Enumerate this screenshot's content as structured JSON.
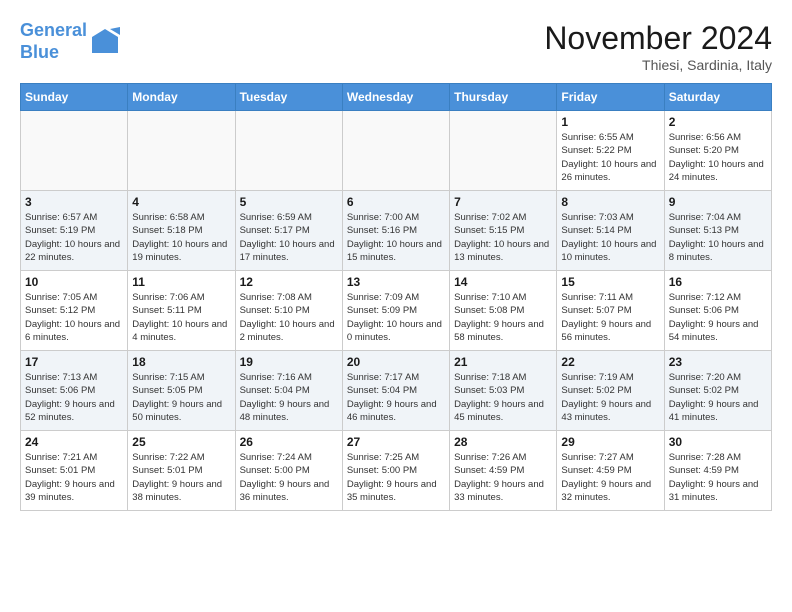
{
  "header": {
    "logo_line1": "General",
    "logo_line2": "Blue",
    "month_title": "November 2024",
    "subtitle": "Thiesi, Sardinia, Italy"
  },
  "weekdays": [
    "Sunday",
    "Monday",
    "Tuesday",
    "Wednesday",
    "Thursday",
    "Friday",
    "Saturday"
  ],
  "weeks": [
    [
      {
        "day": "",
        "info": ""
      },
      {
        "day": "",
        "info": ""
      },
      {
        "day": "",
        "info": ""
      },
      {
        "day": "",
        "info": ""
      },
      {
        "day": "",
        "info": ""
      },
      {
        "day": "1",
        "info": "Sunrise: 6:55 AM\nSunset: 5:22 PM\nDaylight: 10 hours and 26 minutes."
      },
      {
        "day": "2",
        "info": "Sunrise: 6:56 AM\nSunset: 5:20 PM\nDaylight: 10 hours and 24 minutes."
      }
    ],
    [
      {
        "day": "3",
        "info": "Sunrise: 6:57 AM\nSunset: 5:19 PM\nDaylight: 10 hours and 22 minutes."
      },
      {
        "day": "4",
        "info": "Sunrise: 6:58 AM\nSunset: 5:18 PM\nDaylight: 10 hours and 19 minutes."
      },
      {
        "day": "5",
        "info": "Sunrise: 6:59 AM\nSunset: 5:17 PM\nDaylight: 10 hours and 17 minutes."
      },
      {
        "day": "6",
        "info": "Sunrise: 7:00 AM\nSunset: 5:16 PM\nDaylight: 10 hours and 15 minutes."
      },
      {
        "day": "7",
        "info": "Sunrise: 7:02 AM\nSunset: 5:15 PM\nDaylight: 10 hours and 13 minutes."
      },
      {
        "day": "8",
        "info": "Sunrise: 7:03 AM\nSunset: 5:14 PM\nDaylight: 10 hours and 10 minutes."
      },
      {
        "day": "9",
        "info": "Sunrise: 7:04 AM\nSunset: 5:13 PM\nDaylight: 10 hours and 8 minutes."
      }
    ],
    [
      {
        "day": "10",
        "info": "Sunrise: 7:05 AM\nSunset: 5:12 PM\nDaylight: 10 hours and 6 minutes."
      },
      {
        "day": "11",
        "info": "Sunrise: 7:06 AM\nSunset: 5:11 PM\nDaylight: 10 hours and 4 minutes."
      },
      {
        "day": "12",
        "info": "Sunrise: 7:08 AM\nSunset: 5:10 PM\nDaylight: 10 hours and 2 minutes."
      },
      {
        "day": "13",
        "info": "Sunrise: 7:09 AM\nSunset: 5:09 PM\nDaylight: 10 hours and 0 minutes."
      },
      {
        "day": "14",
        "info": "Sunrise: 7:10 AM\nSunset: 5:08 PM\nDaylight: 9 hours and 58 minutes."
      },
      {
        "day": "15",
        "info": "Sunrise: 7:11 AM\nSunset: 5:07 PM\nDaylight: 9 hours and 56 minutes."
      },
      {
        "day": "16",
        "info": "Sunrise: 7:12 AM\nSunset: 5:06 PM\nDaylight: 9 hours and 54 minutes."
      }
    ],
    [
      {
        "day": "17",
        "info": "Sunrise: 7:13 AM\nSunset: 5:06 PM\nDaylight: 9 hours and 52 minutes."
      },
      {
        "day": "18",
        "info": "Sunrise: 7:15 AM\nSunset: 5:05 PM\nDaylight: 9 hours and 50 minutes."
      },
      {
        "day": "19",
        "info": "Sunrise: 7:16 AM\nSunset: 5:04 PM\nDaylight: 9 hours and 48 minutes."
      },
      {
        "day": "20",
        "info": "Sunrise: 7:17 AM\nSunset: 5:04 PM\nDaylight: 9 hours and 46 minutes."
      },
      {
        "day": "21",
        "info": "Sunrise: 7:18 AM\nSunset: 5:03 PM\nDaylight: 9 hours and 45 minutes."
      },
      {
        "day": "22",
        "info": "Sunrise: 7:19 AM\nSunset: 5:02 PM\nDaylight: 9 hours and 43 minutes."
      },
      {
        "day": "23",
        "info": "Sunrise: 7:20 AM\nSunset: 5:02 PM\nDaylight: 9 hours and 41 minutes."
      }
    ],
    [
      {
        "day": "24",
        "info": "Sunrise: 7:21 AM\nSunset: 5:01 PM\nDaylight: 9 hours and 39 minutes."
      },
      {
        "day": "25",
        "info": "Sunrise: 7:22 AM\nSunset: 5:01 PM\nDaylight: 9 hours and 38 minutes."
      },
      {
        "day": "26",
        "info": "Sunrise: 7:24 AM\nSunset: 5:00 PM\nDaylight: 9 hours and 36 minutes."
      },
      {
        "day": "27",
        "info": "Sunrise: 7:25 AM\nSunset: 5:00 PM\nDaylight: 9 hours and 35 minutes."
      },
      {
        "day": "28",
        "info": "Sunrise: 7:26 AM\nSunset: 4:59 PM\nDaylight: 9 hours and 33 minutes."
      },
      {
        "day": "29",
        "info": "Sunrise: 7:27 AM\nSunset: 4:59 PM\nDaylight: 9 hours and 32 minutes."
      },
      {
        "day": "30",
        "info": "Sunrise: 7:28 AM\nSunset: 4:59 PM\nDaylight: 9 hours and 31 minutes."
      }
    ]
  ]
}
